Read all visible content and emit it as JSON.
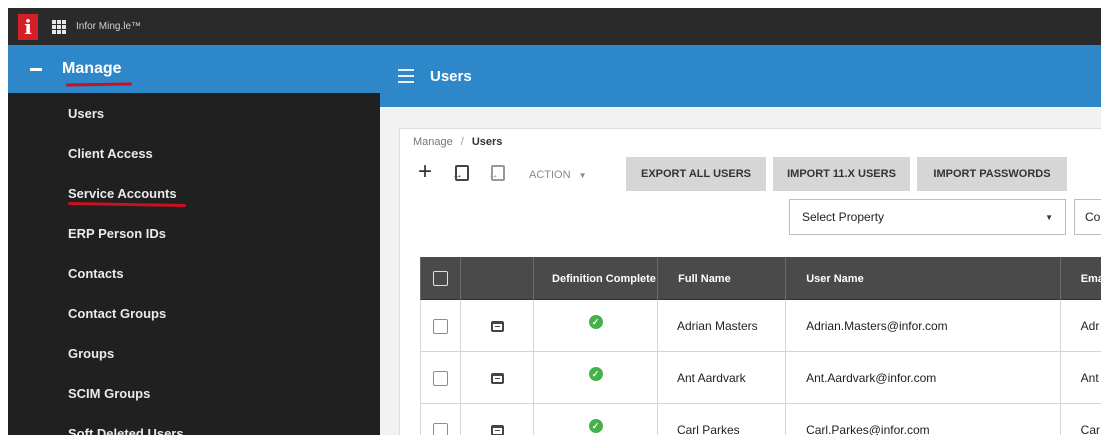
{
  "app": {
    "title": "Infor Ming.le™",
    "logo_letter": "i"
  },
  "sidebar": {
    "header_label": "Manage",
    "items": [
      {
        "label": "Users"
      },
      {
        "label": "Client Access"
      },
      {
        "label": "Service Accounts"
      },
      {
        "label": "ERP Person IDs"
      },
      {
        "label": "Contacts"
      },
      {
        "label": "Contact Groups"
      },
      {
        "label": "Groups"
      },
      {
        "label": "SCIM Groups"
      },
      {
        "label": "Soft Deleted Users"
      }
    ]
  },
  "main": {
    "title": "Users",
    "breadcrumb": {
      "root": "Manage",
      "separator": "/",
      "current": "Users"
    },
    "toolbar": {
      "action_label": "ACTION",
      "buttons": [
        "EXPORT ALL USERS",
        "IMPORT 11.X USERS",
        "IMPORT PASSWORDS"
      ]
    },
    "filter": {
      "property_select": "Select Property",
      "second_select": "Co"
    },
    "table": {
      "columns": [
        "",
        "",
        "Definition Complete",
        "Full Name",
        "User Name",
        "Ema"
      ],
      "rows": [
        {
          "full_name": "Adrian Masters",
          "user_name": "Adrian.Masters@infor.com",
          "email": "Adr"
        },
        {
          "full_name": "Ant Aardvark",
          "user_name": "Ant.Aardvark@infor.com",
          "email": "Ant"
        },
        {
          "full_name": "Carl Parkes",
          "user_name": "Carl.Parkes@infor.com",
          "email": "Car"
        }
      ]
    }
  },
  "colors": {
    "topbar": "#2a2a2a",
    "sidebar": "#202020",
    "accent_blue": "#2d87c8",
    "logo_red": "#d32027",
    "annotation_red": "#c8101e",
    "table_header": "#4a4a4a",
    "check_green": "#44b14a"
  },
  "icons": [
    "app-grid-icon",
    "collapse-icon",
    "hamburger-icon",
    "plus-icon",
    "import-icon",
    "export-icon",
    "caret-down-icon",
    "checkbox-icon",
    "user-card-icon",
    "check-circle-icon"
  ]
}
